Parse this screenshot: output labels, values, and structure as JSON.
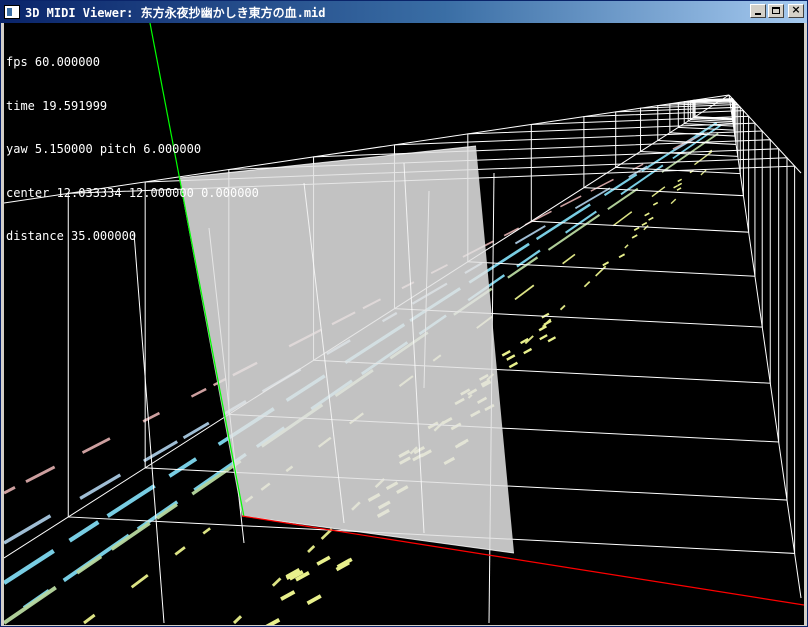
{
  "window": {
    "title": "3D MIDI Viewer: 东方永夜抄幽かしき東方の血.mid",
    "controls": {
      "minimize": "minimize",
      "maximize": "maximize",
      "close": "×"
    }
  },
  "hud": {
    "fps": "fps 60.000000",
    "time": "time 19.591999",
    "yaw_pitch": "yaw 5.150000 pitch 6.000000",
    "center": "center 12.033334 12.000000 0.000000",
    "distance": "distance 35.000000"
  },
  "colors": {
    "background": "#000000",
    "grid": "#ffffff",
    "playhead_plane": "#e2e2e2",
    "x_axis": "#ff0000",
    "y_axis": "#00ff00",
    "note_cyan": "#7fd8f0",
    "note_yellow": "#e8f08c",
    "note_green": "#b8d8a0",
    "note_blue": "#a8c8e0",
    "note_pink": "#d8a8a8"
  }
}
